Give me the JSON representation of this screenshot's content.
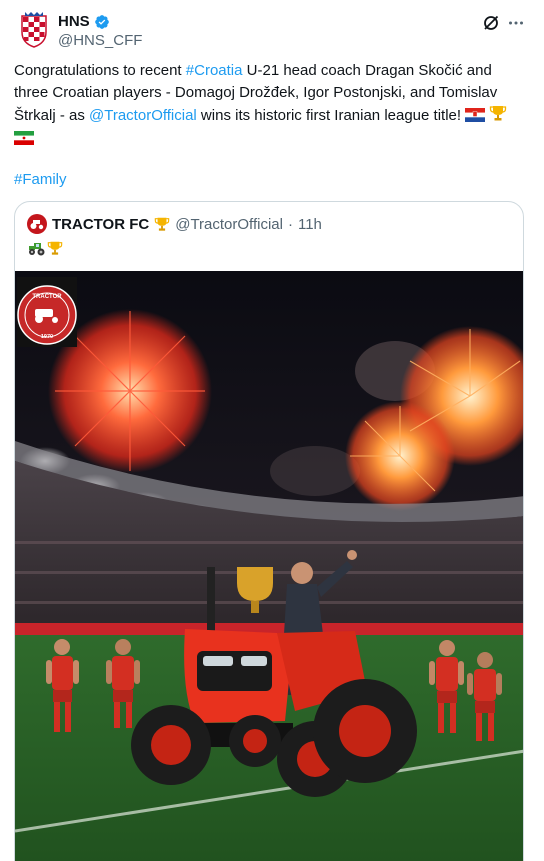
{
  "author": {
    "display_name": "HNS",
    "handle": "@HNS_CFF"
  },
  "tweet": {
    "text_before_hashtag": "Congratulations to recent ",
    "hashtag_croatia": "#Croatia",
    "text_middle": " U-21 head coach Dragan Skočić and three Croatian players - Domagoj Drožđek, Igor Postonjski, and Tomislav Štrkalj - as ",
    "mention_tractor": "@TractorOfficial",
    "text_end": " wins its historic first Iranian league title! ",
    "hashtag_family": "#Family"
  },
  "quote": {
    "display_name": "TRACTOR FC",
    "handle": "@TractorOfficial",
    "separator": "·",
    "time": "11h",
    "logo_text_top": "TRACTOR",
    "logo_year": "1970"
  },
  "icons": [
    "croatia-crest-icon",
    "verified-badge-icon",
    "grok-icon",
    "more-options-icon",
    "croatia-flag-icon",
    "trophy-icon",
    "iran-flag-icon",
    "tractor-icon"
  ],
  "colors": {
    "link": "#1d9bf0",
    "secondary_text": "#536471",
    "tractor_red": "#e8321e"
  }
}
